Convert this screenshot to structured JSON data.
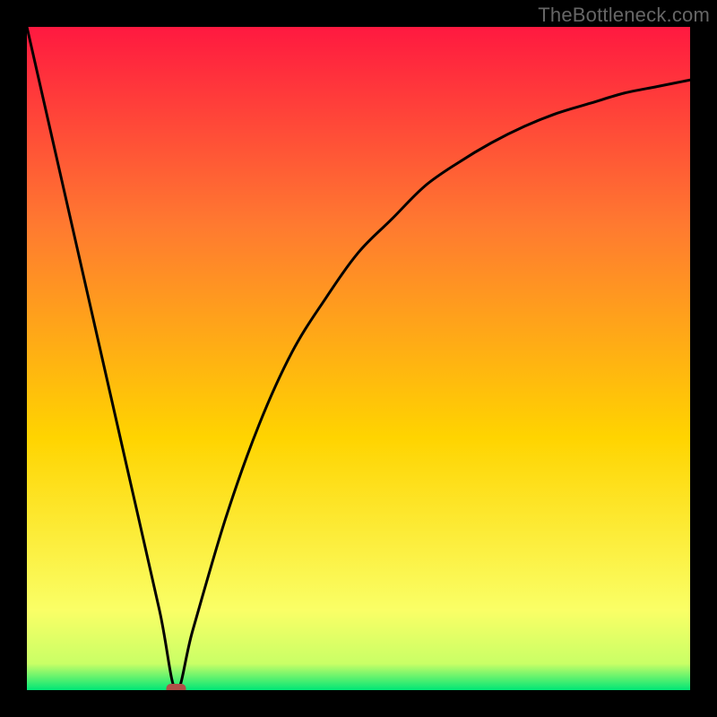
{
  "watermark": "TheBottleneck.com",
  "chart_data": {
    "type": "line",
    "title": "",
    "xlabel": "",
    "ylabel": "",
    "xlim": [
      0,
      100
    ],
    "ylim": [
      0,
      100
    ],
    "grid": false,
    "legend": false,
    "background_gradient": {
      "top_color": "#ff1940",
      "mid_color": "#ffd400",
      "bottom_color": "#00e676"
    },
    "marker": {
      "x": 22.5,
      "y": 0,
      "color": "#b05048",
      "shape": "rounded-rect"
    },
    "series": [
      {
        "name": "curve",
        "x": [
          0,
          5,
          10,
          15,
          20,
          22.5,
          25,
          30,
          35,
          40,
          45,
          50,
          55,
          60,
          65,
          70,
          75,
          80,
          85,
          90,
          95,
          100
        ],
        "values": [
          100,
          78,
          56,
          34,
          12,
          0,
          9,
          26,
          40,
          51,
          59,
          66,
          71,
          76,
          79.5,
          82.5,
          85,
          87,
          88.5,
          90,
          91,
          92
        ]
      }
    ]
  }
}
